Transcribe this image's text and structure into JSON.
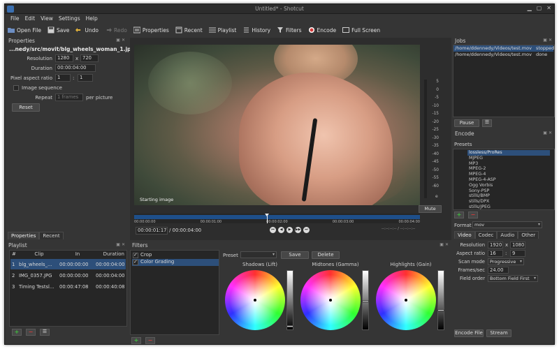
{
  "window": {
    "title": "Untitled* - Shotcut"
  },
  "menu": [
    "File",
    "Edit",
    "View",
    "Settings",
    "Help"
  ],
  "toolbar": {
    "open_file": "Open File",
    "save": "Save",
    "undo": "Undo",
    "redo": "Redo",
    "properties": "Properties",
    "recent": "Recent",
    "playlist": "Playlist",
    "history": "History",
    "filters": "Filters",
    "encode": "Encode",
    "full_screen": "Full Screen"
  },
  "properties": {
    "title": "Properties",
    "filename": "...nedy/src/movit/blg_wheels_woman_1.jpg",
    "resolution_label": "Resolution",
    "res_w": "1280",
    "res_x": "x",
    "res_h": "720",
    "duration_label": "Duration",
    "duration": "00:00:04:00",
    "par_label": "Pixel aspect ratio",
    "par_num": "1",
    "par_sep": ":",
    "par_den": "1",
    "image_sequence": "Image sequence",
    "repeat_label": "Repeat",
    "repeat_value": "1 frames",
    "repeat_suffix": "per picture",
    "reset": "Reset",
    "tabs": [
      "Properties",
      "Recent"
    ]
  },
  "playlist": {
    "title": "Playlist",
    "columns": [
      "#",
      "Clip",
      "In",
      "Duration"
    ],
    "rows": [
      {
        "n": "1",
        "clip": "blg_wheels_...",
        "in": "00:00:00:00",
        "duration": "00:00:04:00"
      },
      {
        "n": "2",
        "clip": "IMG_0357.JPG",
        "in": "00:00:00:00",
        "duration": "00:00:04:00"
      },
      {
        "n": "3",
        "clip": "Timing Testsl...",
        "in": "00:00:47:08",
        "duration": "00:00:40:08"
      }
    ]
  },
  "viewer": {
    "caption": "Starting image",
    "meter": [
      "5",
      "0",
      "-5",
      "-10",
      "-15",
      "-20",
      "-25",
      "-30",
      "-35",
      "-40",
      "-45",
      "-50",
      "-55",
      "-60"
    ],
    "meter_unit": "e",
    "mute": "Mute",
    "ruler": [
      "00:00:00:00",
      "00:00:01:00",
      "00:00:02:00",
      "00:00:03:00",
      "00:00:04:00"
    ],
    "current_time": "00:00:01:17",
    "total_time": "/ 00:00:04:00",
    "right_time": "--:--:--:-- / --:--:--:--"
  },
  "filters": {
    "title": "Filters",
    "items": [
      {
        "label": "Crop",
        "checked": true
      },
      {
        "label": "Color Grading",
        "checked": true
      }
    ],
    "preset_label": "Preset",
    "save": "Save",
    "delete": "Delete",
    "wheels": [
      "Shadows (Lift)",
      "Midtones (Gamma)",
      "Highlights (Gain)"
    ]
  },
  "jobs": {
    "title": "Jobs",
    "rows": [
      {
        "path": "/home/ddennedy/Videos/test.mov",
        "status": "stopped"
      },
      {
        "path": "/home/ddennedy/Videos/test.mov",
        "status": "done"
      }
    ],
    "pause": "Pause"
  },
  "encode": {
    "title": "Encode",
    "presets_label": "Presets",
    "presets": [
      "lossless/ProRes",
      "MJPEG",
      "MP3",
      "MPEG-2",
      "MPEG-4",
      "MPEG-4-ASP",
      "Ogg Vorbis",
      "Sony-PSP",
      "stills/BMP",
      "stills/DPX",
      "stills/JPEG"
    ],
    "format_label": "Format",
    "format": "mov",
    "tabs": [
      "Video",
      "Codec",
      "Audio",
      "Other"
    ],
    "resolution_label": "Resolution",
    "res_w": "1920",
    "res_x": "x",
    "res_h": "1080",
    "aspect_label": "Aspect ratio",
    "aspect_w": "16",
    "aspect_sep": ":",
    "aspect_h": "9",
    "scan_label": "Scan mode",
    "scan": "Progressive",
    "fps_label": "Frames/sec",
    "fps": "24.00",
    "field_label": "Field order",
    "field": "Bottom Field First",
    "encode_file": "Encode File",
    "stream": "Stream"
  },
  "colors": {
    "accent": "#2d4f7a",
    "timeline": "#1e4f8a",
    "add": "#3fbf3f",
    "remove": "#d23a3a"
  }
}
